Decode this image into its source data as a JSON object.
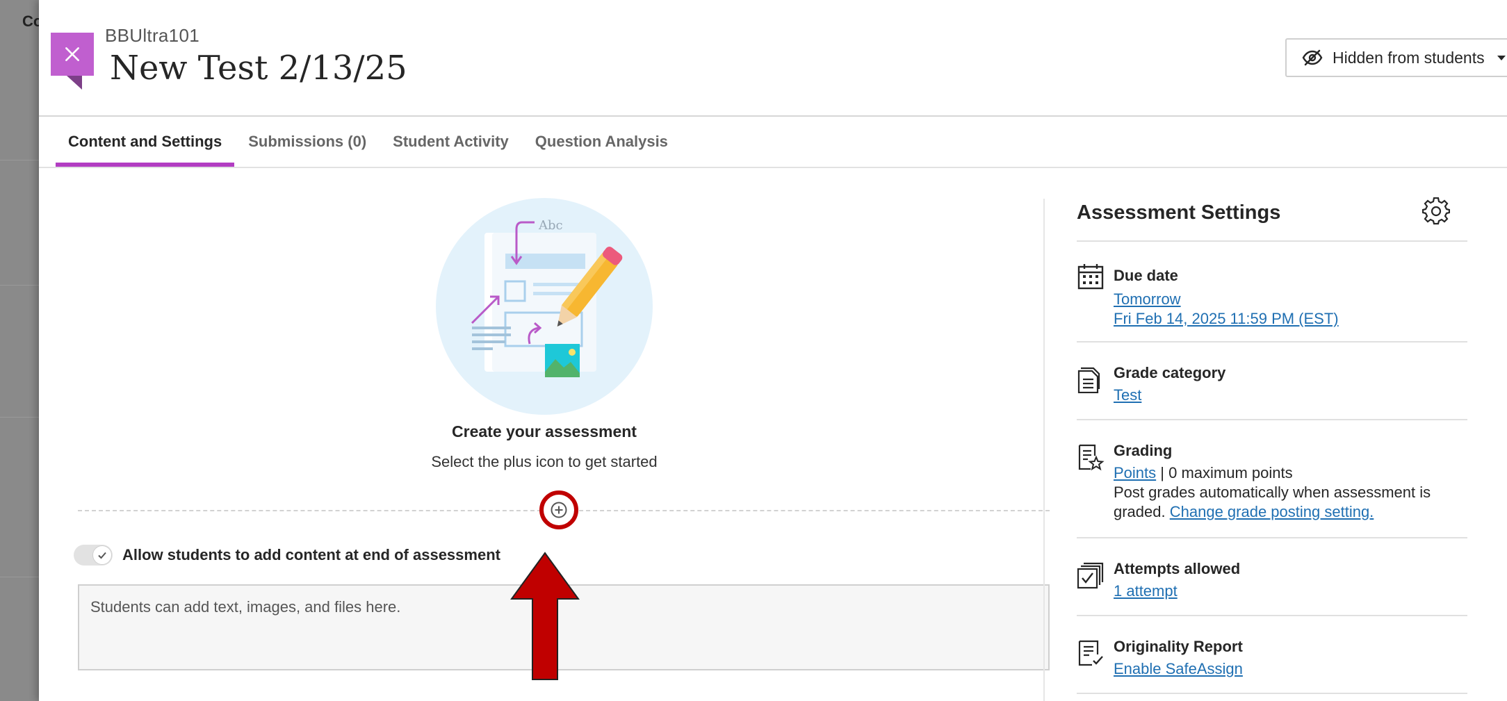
{
  "background": {
    "partial_text": "Co"
  },
  "header": {
    "course_name": "BBUltra101",
    "test_title": "New Test 2/13/25",
    "visibility_label": "Hidden from students"
  },
  "tabs": [
    {
      "label": "Content and Settings",
      "active": true
    },
    {
      "label": "Submissions (0)",
      "active": false
    },
    {
      "label": "Student Activity",
      "active": false
    },
    {
      "label": "Question Analysis",
      "active": false
    }
  ],
  "main": {
    "illustration_text": "Abc",
    "create_title": "Create your assessment",
    "create_subtitle": "Select the plus icon to get started",
    "toggle_label": "Allow students to add content at end of assessment",
    "toggle_on": true,
    "textarea_placeholder": "Students can add text, images, and files here."
  },
  "settings": {
    "title": "Assessment Settings",
    "due_date": {
      "heading": "Due date",
      "relative": "Tomorrow",
      "absolute": "Fri Feb 14, 2025 11:59 PM (EST)"
    },
    "grade_category": {
      "heading": "Grade category",
      "value": "Test"
    },
    "grading": {
      "heading": "Grading",
      "scheme_link": "Points",
      "separator": " | ",
      "max_points": "0 maximum points",
      "post_text_line1": "Post grades automatically when assessment is",
      "post_text_line2": "graded.",
      "change_link": "Change grade posting setting."
    },
    "attempts": {
      "heading": "Attempts allowed",
      "value": "1 attempt"
    },
    "originality": {
      "heading": "Originality Report",
      "value": "Enable SafeAssign"
    }
  },
  "colors": {
    "accent": "#b23dc2",
    "close_button": "#c05fcf",
    "link": "#1f6fb2",
    "annotation_red": "#c00000"
  }
}
